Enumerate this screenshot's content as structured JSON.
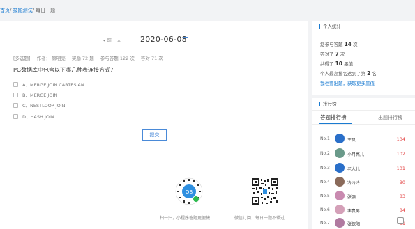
{
  "breadcrumb": {
    "home": "首页",
    "sep1": "/",
    "section": "技能测试",
    "sep2": "/",
    "current": "每日一题"
  },
  "date_nav": {
    "prev_label": "前一天",
    "date": "2020-06-08"
  },
  "question": {
    "type": "[多选题]",
    "author": "作者： 原明亮",
    "points": "奖励 72 题",
    "participants": "参与答题 122 次",
    "accuracy": "答对 71 次",
    "text": "PG数据库中包含以下哪几种表连接方式？",
    "options": [
      "A、MERGE JOIN CARTESIAN",
      "B、MERGE JOIN",
      "C、NESTLOOP JOIN",
      "D、HASH JOIN"
    ],
    "submit_label": "提交"
  },
  "qr": {
    "left_caption": "扫一扫，小程序答题更便捷",
    "right_caption": "微信订阅，每日一题不错过",
    "left_logo": "OB"
  },
  "personal_stats": {
    "title": "个人统计",
    "line1_prefix": "您参与答题",
    "line1_value": "14",
    "line1_suffix": "次",
    "line2_prefix": "答对了",
    "line2_value": "7",
    "line2_suffix": "次",
    "line3_prefix": "共得了",
    "line3_value": "10",
    "line3_suffix": "墨值",
    "line4_prefix": "个人最高排名达到了第",
    "line4_value": "2",
    "line4_suffix": "名",
    "link": "我也要出题，获取更多墨值"
  },
  "leaderboard": {
    "title": "排行榜",
    "tab_active": "答题排行榜",
    "tab_other": "出题排行榜",
    "rows": [
      {
        "rank": "No.1",
        "name": "王贝",
        "score": "104",
        "color": "#2a6fc9"
      },
      {
        "rank": "No.2",
        "name": "小月亮儿",
        "score": "102",
        "color": "#6a9a8a"
      },
      {
        "rank": "No.3",
        "name": "老人儿",
        "score": "101",
        "color": "#2a6fc9"
      },
      {
        "rank": "No.4",
        "name": "冷冷冷",
        "score": "90",
        "color": "#8a6a5a"
      },
      {
        "rank": "No.5",
        "name": "张强",
        "score": "83",
        "color": "#c98ab0"
      },
      {
        "rank": "No.6",
        "name": "李贵男",
        "score": "84",
        "color": "#d4a0b8"
      },
      {
        "rank": "No.7",
        "name": "张保阳",
        "score": "81",
        "color": "#b07aa0"
      }
    ]
  }
}
